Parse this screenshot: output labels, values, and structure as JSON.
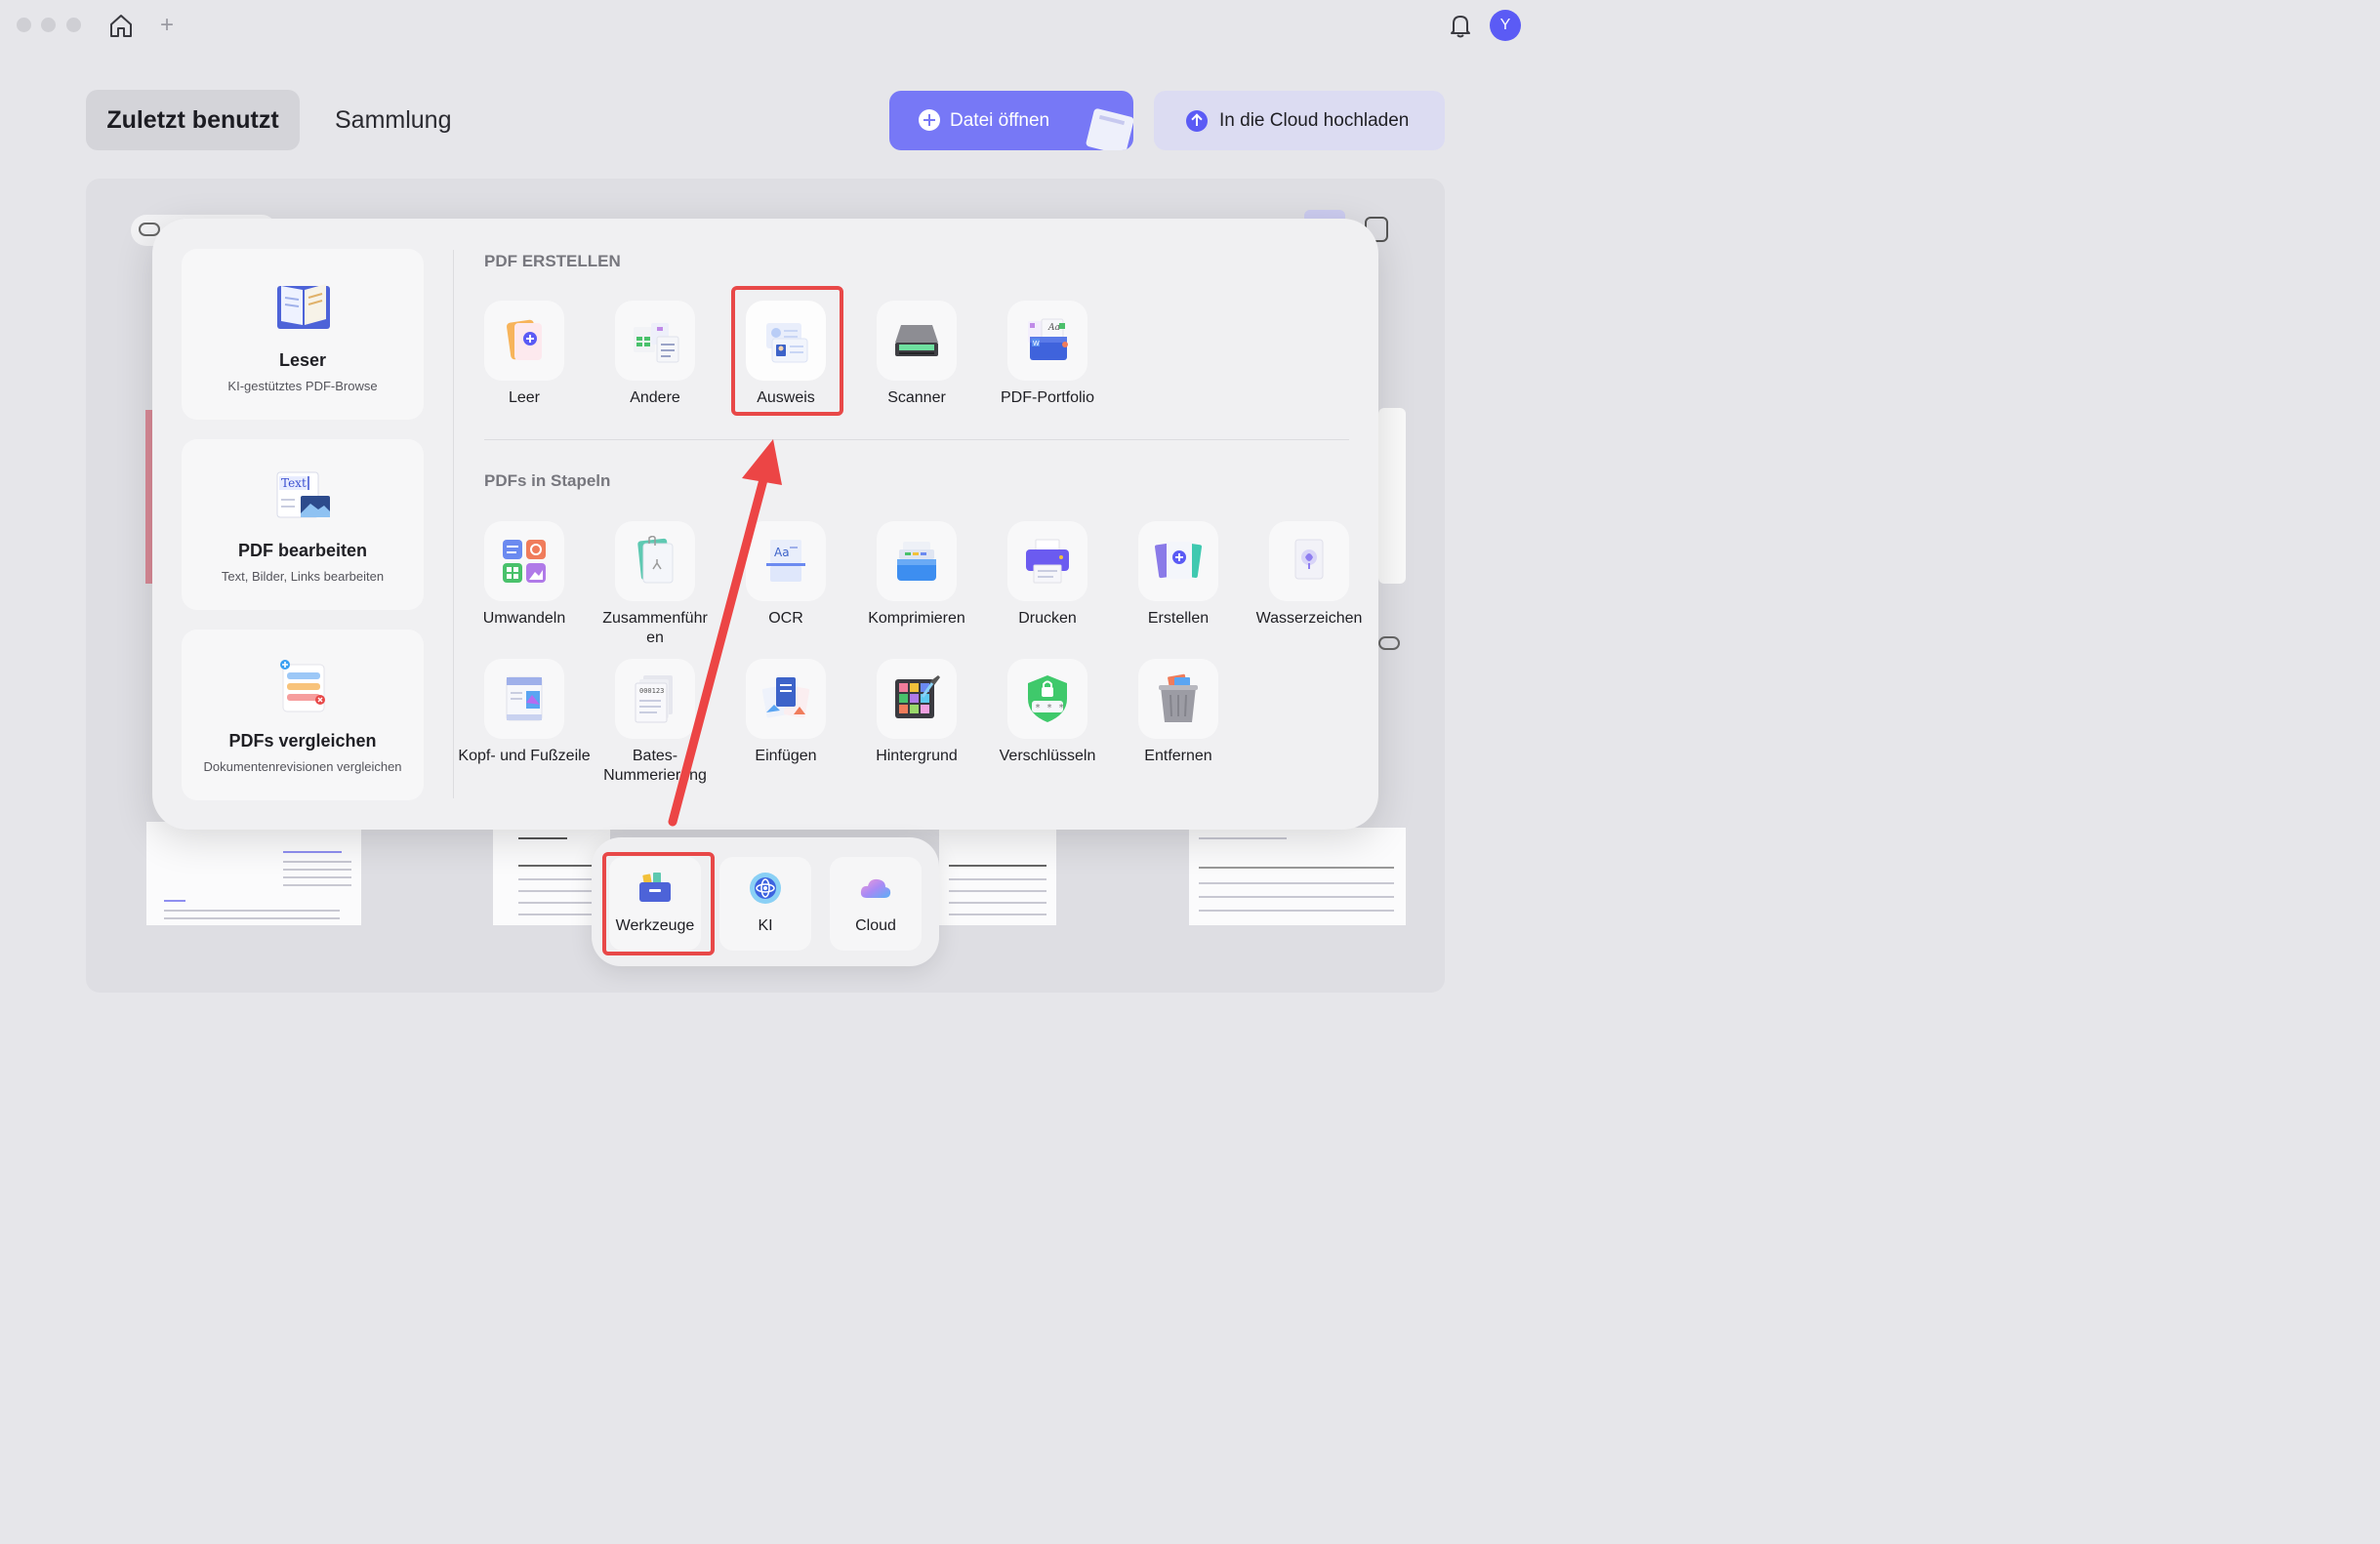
{
  "window": {
    "avatar_initial": "Y",
    "new_tab_symbol": "+",
    "icons": [
      "home-icon",
      "plus-icon",
      "bell-icon"
    ]
  },
  "header": {
    "tab_recent": "Zuletzt benutzt",
    "tab_collection": "Sammlung",
    "open_file": "Datei öffnen",
    "upload_cloud": "In die Cloud hochladen"
  },
  "sidebar": [
    {
      "title": "Leser",
      "subtitle": "KI-gestütztes PDF-Browse",
      "icon": "book-icon"
    },
    {
      "title": "PDF bearbeiten",
      "subtitle": "Text, Bilder, Links bearbeiten",
      "icon": "edit-text-icon"
    },
    {
      "title": "PDFs vergleichen",
      "subtitle": "Dokumentenrevisionen vergleichen",
      "icon": "compare-icon"
    }
  ],
  "create_section": {
    "title": "PDF ERSTELLEN",
    "tools": [
      {
        "label": "Leer",
        "icon": "blank-page-icon"
      },
      {
        "label": "Andere",
        "icon": "other-files-icon"
      },
      {
        "label": "Ausweis",
        "icon": "id-card-icon",
        "highlighted": true
      },
      {
        "label": "Scanner",
        "icon": "scanner-icon"
      },
      {
        "label": "PDF-Portfolio",
        "icon": "portfolio-icon"
      }
    ]
  },
  "batch_section": {
    "title": "PDFs in Stapeln",
    "row1": [
      {
        "label": "Umwandeln",
        "icon": "convert-icon"
      },
      {
        "label": "Zusammenführen",
        "label_display": "Zusammenführ\nen",
        "icon": "merge-icon"
      },
      {
        "label": "OCR",
        "icon": "ocr-icon"
      },
      {
        "label": "Komprimieren",
        "icon": "compress-icon"
      },
      {
        "label": "Drucken",
        "icon": "printer-icon"
      },
      {
        "label": "Erstellen",
        "icon": "create-icon"
      },
      {
        "label": "Wasserzeichen",
        "icon": "watermark-icon"
      }
    ],
    "row2": [
      {
        "label": "Kopf- und Fußzeile",
        "icon": "header-footer-icon"
      },
      {
        "label": "Bates-Nummerierung",
        "icon": "bates-icon"
      },
      {
        "label": "Einfügen",
        "icon": "insert-icon"
      },
      {
        "label": "Hintergrund",
        "icon": "background-icon"
      },
      {
        "label": "Verschlüsseln",
        "icon": "encrypt-icon"
      },
      {
        "label": "Entfernen",
        "icon": "trash-icon"
      }
    ]
  },
  "dock": [
    {
      "label": "Werkzeuge",
      "icon": "toolbox-icon",
      "highlighted": true
    },
    {
      "label": "KI",
      "icon": "ai-icon"
    },
    {
      "label": "Cloud",
      "icon": "cloud-icon"
    }
  ],
  "colors": {
    "accent": "#7778f6",
    "highlight": "#e84848",
    "panel": "#f0f0f2"
  }
}
